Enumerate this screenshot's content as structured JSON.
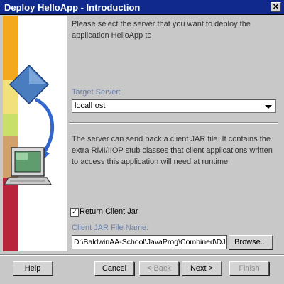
{
  "window": {
    "title": "Deploy HelloApp - Introduction",
    "close_glyph": "✕"
  },
  "intro": {
    "text": "Please select the server that you want to deploy the application HelloApp to"
  },
  "target_server": {
    "label": "Target Server:",
    "value": "localhost"
  },
  "client_jar_info": {
    "text": "The server can send back a client JAR file. It contains the extra RMI/IIOP stub classes that client applications written to access this application will need at runtime"
  },
  "return_client_jar": {
    "checked": true,
    "check_glyph": "✓",
    "label": "Return Client Jar"
  },
  "client_jar_file": {
    "label": "Client JAR File Name:",
    "value": "D:\\BaldwinAA-School\\JavaProg\\Combined\\DJD\\",
    "browse_label": "Browse..."
  },
  "buttons": {
    "help": "Help",
    "cancel": "Cancel",
    "back": "< Back",
    "next": "Next >",
    "finish": "Finish"
  },
  "colors": {
    "title_bar": "#0f2a8c",
    "label_blue": "#6b7fa8",
    "stripe_orange": "#f4a81c",
    "stripe_yellow": "#f2e07a",
    "stripe_green": "#c8df6a",
    "stripe_tan": "#d2a06a",
    "stripe_red": "#b8243c"
  },
  "icons": {
    "side_graphic": [
      "diamond-icon",
      "arrow-icon",
      "computer-monitor-icon"
    ]
  }
}
